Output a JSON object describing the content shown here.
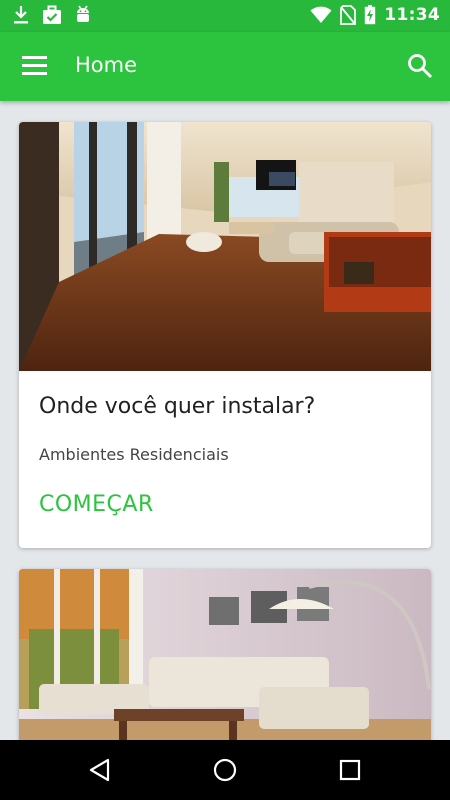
{
  "status_bar": {
    "time": "11:34",
    "icons": [
      "download-icon",
      "briefcase-check-icon",
      "android-debug-icon",
      "wifi-icon",
      "no-sim-icon",
      "battery-charging-icon"
    ]
  },
  "app_bar": {
    "title": "Home",
    "menu_icon": "menu-icon",
    "search_icon": "search-icon"
  },
  "cards": [
    {
      "image": "living-room-photo",
      "title": "Onde você quer instalar?",
      "subtitle": "Ambientes Residenciais",
      "action": "COMEÇAR"
    },
    {
      "image": "modern-lounge-photo"
    }
  ],
  "nav_bar": {
    "icons": [
      "back-icon",
      "home-icon",
      "recents-icon"
    ]
  },
  "colors": {
    "status_bar": "#28b83b",
    "app_bar": "#2cc33f",
    "accent": "#2cc33f",
    "background": "#e3e7ea"
  }
}
